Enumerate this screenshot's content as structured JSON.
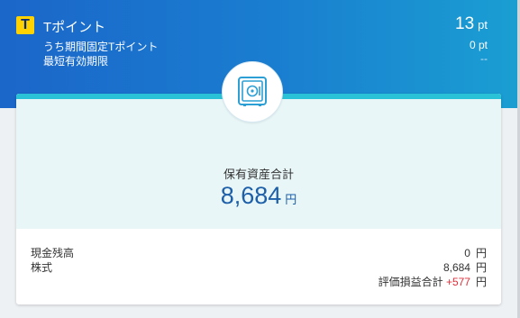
{
  "tpoint": {
    "logo_letter": "T",
    "label": "Tポイント",
    "value": "13",
    "unit": "pt",
    "limited_label": "うち期間固定Tポイント",
    "limited_value": "0 pt",
    "expiry_label": "最短有効期限",
    "expiry_value": "--"
  },
  "assets": {
    "label": "保有資産合計",
    "value": "8,684",
    "unit": "円",
    "icon": "safe-icon"
  },
  "breakdown": {
    "cash_label": "現金残高",
    "cash_value": "0",
    "stock_label": "株式",
    "stock_value": "8,684",
    "pl_label": "評価損益合計",
    "pl_value": "+577",
    "unit": "円"
  },
  "colors": {
    "header_start": "#1b66c9",
    "header_end": "#1a9fd2",
    "accent_teal": "#29c2d6",
    "asset_value": "#1d5fa8",
    "profit": "#e0303a"
  }
}
